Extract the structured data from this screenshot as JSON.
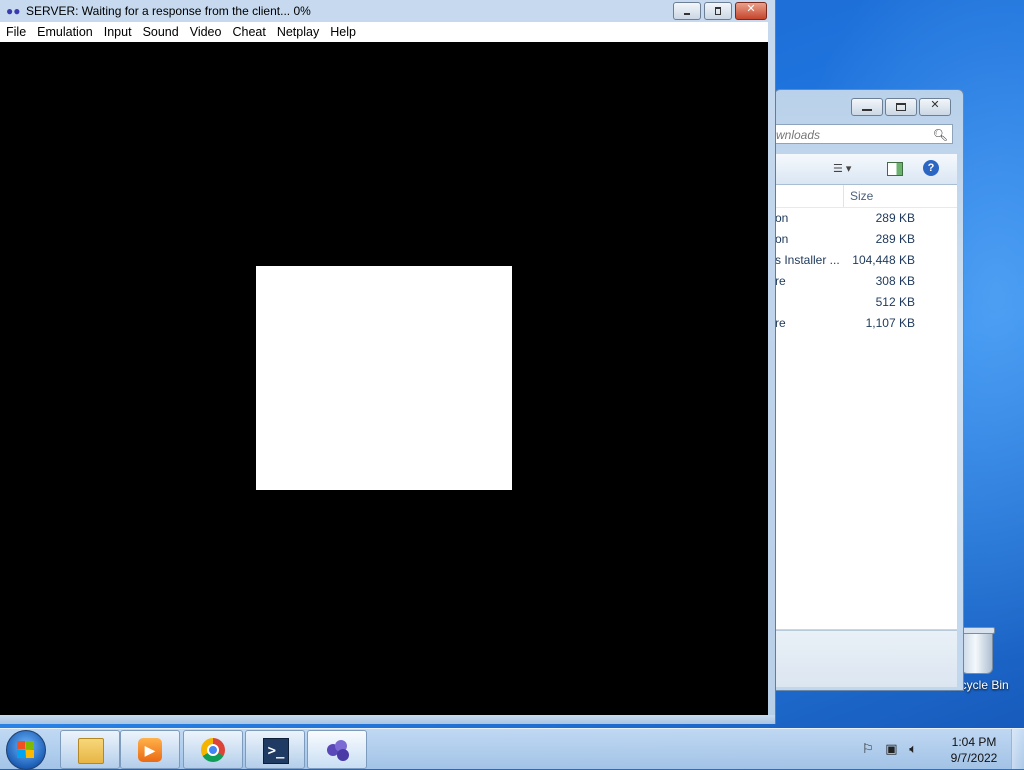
{
  "emulator": {
    "title": "SERVER: Waiting for a response from the client...  0%",
    "menu": [
      "File",
      "Emulation",
      "Input",
      "Sound",
      "Video",
      "Cheat",
      "Netplay",
      "Help"
    ]
  },
  "explorer": {
    "search_placeholder": "wnloads",
    "size_header": "Size",
    "rows": [
      {
        "name": "on",
        "size": "289 KB"
      },
      {
        "name": "on",
        "size": "289 KB"
      },
      {
        "name": "s Installer ...",
        "size": "104,448 KB"
      },
      {
        "name": "re",
        "size": "308 KB"
      },
      {
        "name": "",
        "size": "512 KB"
      },
      {
        "name": "re",
        "size": "1,107 KB"
      }
    ]
  },
  "desktop": {
    "recycle_bin_label": "Recycle Bin"
  },
  "taskbar": {
    "pinned": [
      "explorer-icon",
      "media-player-icon",
      "chrome-icon",
      "powershell-icon",
      "emulator-icon"
    ],
    "clock": {
      "time": "1:04 PM",
      "date": "9/7/2022"
    }
  },
  "colors": {
    "desktop_blue": "#1f74dd",
    "screen_black": "#000000",
    "close_red": "#c6452c"
  }
}
